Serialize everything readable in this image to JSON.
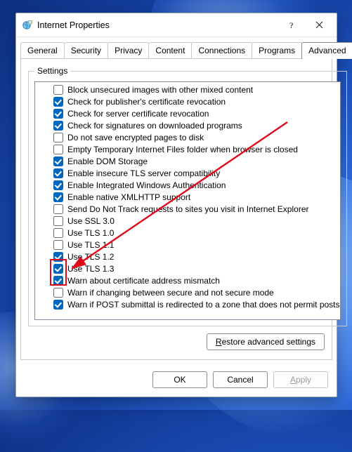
{
  "window": {
    "title": "Internet Properties"
  },
  "tabs": {
    "t0": "General",
    "t1": "Security",
    "t2": "Privacy",
    "t3": "Content",
    "t4": "Connections",
    "t5": "Programs",
    "t6": "Advanced"
  },
  "group_label": "Settings",
  "settings": [
    {
      "checked": false,
      "label": "Block unsecured images with other mixed content"
    },
    {
      "checked": true,
      "label": "Check for publisher's certificate revocation"
    },
    {
      "checked": true,
      "label": "Check for server certificate revocation"
    },
    {
      "checked": true,
      "label": "Check for signatures on downloaded programs"
    },
    {
      "checked": false,
      "label": "Do not save encrypted pages to disk"
    },
    {
      "checked": false,
      "label": "Empty Temporary Internet Files folder when browser is closed"
    },
    {
      "checked": true,
      "label": "Enable DOM Storage"
    },
    {
      "checked": true,
      "label": "Enable insecure TLS server compatibility"
    },
    {
      "checked": true,
      "label": "Enable Integrated Windows Authentication"
    },
    {
      "checked": true,
      "label": "Enable native XMLHTTP support"
    },
    {
      "checked": false,
      "label": "Send Do Not Track requests to sites you visit in Internet Explorer"
    },
    {
      "checked": false,
      "label": "Use SSL 3.0"
    },
    {
      "checked": false,
      "label": "Use TLS 1.0"
    },
    {
      "checked": false,
      "label": "Use TLS 1.1"
    },
    {
      "checked": true,
      "label": "Use TLS 1.2"
    },
    {
      "checked": true,
      "label": "Use TLS 1.3"
    },
    {
      "checked": true,
      "label": "Warn about certificate address mismatch"
    },
    {
      "checked": false,
      "label": "Warn if changing between secure and not secure mode"
    },
    {
      "checked": true,
      "label": "Warn if POST submittal is redirected to a zone that does not permit posts"
    }
  ],
  "buttons": {
    "restore": "Restore advanced settings",
    "ok": "OK",
    "cancel": "Cancel",
    "apply": "Apply"
  },
  "restore_accel": "R",
  "apply_accel": "A"
}
